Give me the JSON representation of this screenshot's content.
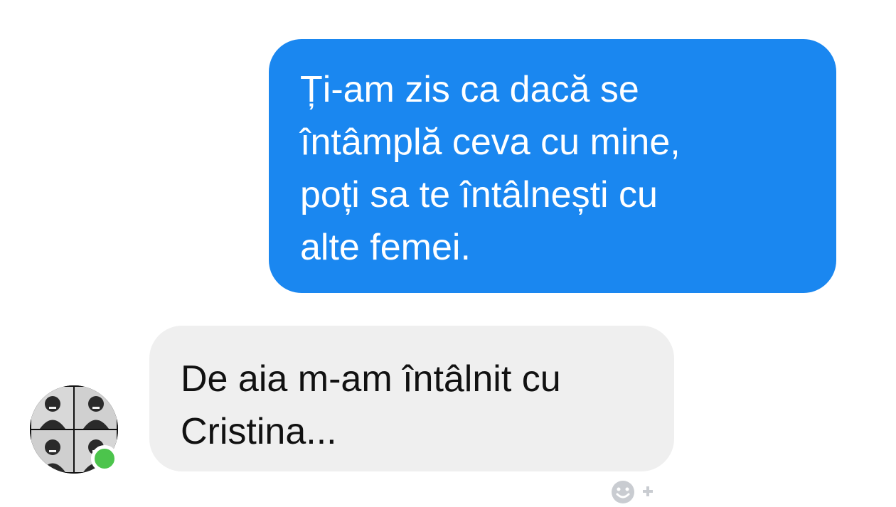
{
  "conversation": {
    "outgoing_message": {
      "text": "Ți-am zis ca dacă se\nîntâmplă ceva cu mine,\npoți sa te întâlnești cu\nalte femei.",
      "bubble_color": "#1a87f0"
    },
    "incoming_message": {
      "text": "De aia m-am întâlnit cu\nCristina...",
      "bubble_color": "#efefef"
    },
    "contact": {
      "avatar_icon": "contact-avatar-icon",
      "presence": "online",
      "presence_color": "#4cc44c"
    },
    "reaction_button": {
      "icon": "smiley-add-reaction-icon"
    }
  }
}
